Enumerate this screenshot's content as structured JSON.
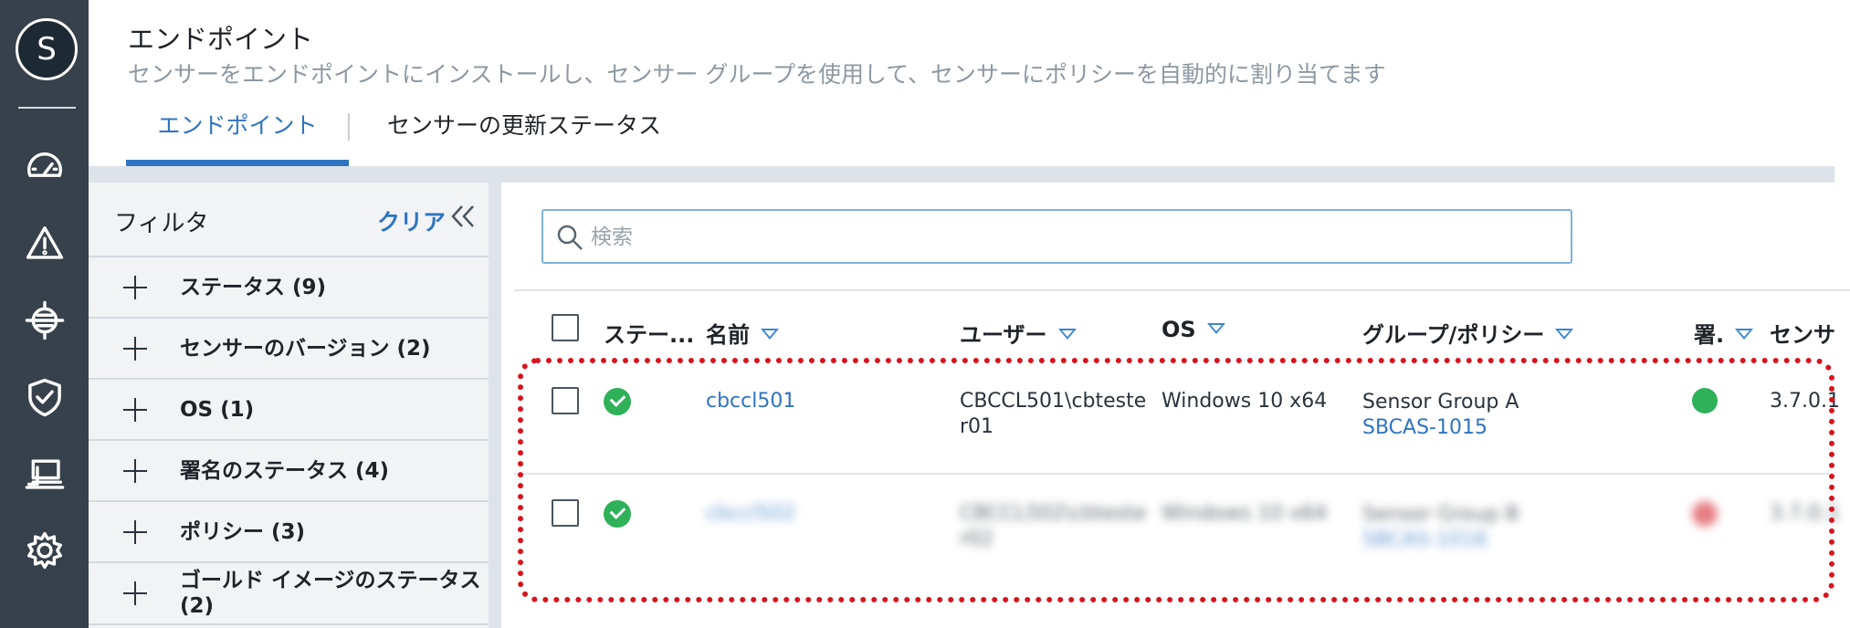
{
  "nav": {
    "avatar_letter": "S",
    "icons": [
      "dashboard-icon",
      "alerts-icon",
      "investigate-icon",
      "enforce-icon",
      "endpoints-icon",
      "settings-icon"
    ]
  },
  "header": {
    "title": "エンドポイント",
    "subtitle": "センサーをエンドポイントにインストールし、センサー グループを使用して、センサーにポリシーを自動的に割り当てます"
  },
  "tabs": [
    {
      "label": "エンドポイント",
      "active": true
    },
    {
      "label": "センサーの更新ステータス",
      "active": false
    }
  ],
  "filter": {
    "title": "フィルタ",
    "clear_label": "クリア",
    "facets": [
      {
        "label": "ステータス (9)"
      },
      {
        "label": "センサーのバージョン (2)"
      },
      {
        "label": "OS (1)"
      },
      {
        "label": "署名のステータス (4)"
      },
      {
        "label": "ポリシー (3)"
      },
      {
        "label": "ゴールド イメージのステータス (2)"
      }
    ]
  },
  "search": {
    "placeholder": "検索",
    "value": ""
  },
  "table": {
    "columns": {
      "status": "ステー...",
      "name": "名前",
      "user": "ユーザー",
      "os": "OS",
      "group_policy": "グループ/ポリシー",
      "signature": "署.",
      "sensor": "センサ"
    },
    "rows": [
      {
        "status": "ok",
        "name": "cbccl501",
        "user_line1": "CBCCL501\\cbteste",
        "user_line2": "r01",
        "os": "Windows 10 x64",
        "group": "Sensor Group A",
        "policy": "SBCAS-1015",
        "signature": "green",
        "sensor_version": "3.7.0.1"
      },
      {
        "status": "ok",
        "name": "cbccl502",
        "user_line1": "CBCCL502\\cbteste",
        "user_line2": "r02",
        "os": "Windows 10 x64",
        "group": "Sensor Group B",
        "policy": "SBCAS-1016",
        "signature": "red",
        "sensor_version": "3.7.0.1"
      }
    ]
  },
  "colors": {
    "rail": "#36414b",
    "accent": "#2f74c0",
    "status_ok": "#2eb158",
    "signature_error": "#e0535b",
    "highlight": "#d7141e"
  }
}
